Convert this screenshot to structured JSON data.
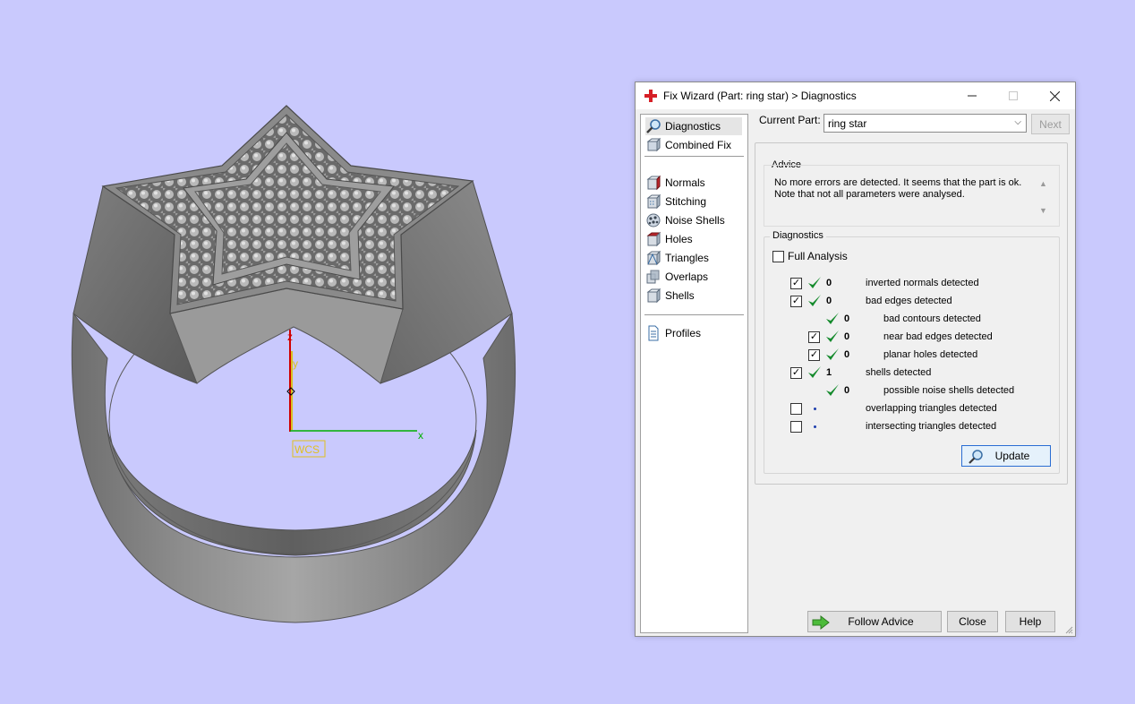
{
  "viewport": {
    "background": "#c9c9fd",
    "axes": {
      "z": "z",
      "y": "y",
      "x": "x",
      "wcs": "WCS"
    }
  },
  "window": {
    "title": "Fix Wizard (Part: ring star) > Diagnostics",
    "minimize_icon": "minimize-icon",
    "maximize_icon": "maximize-icon",
    "close_icon": "close-icon"
  },
  "nav": {
    "items": [
      {
        "label": "Diagnostics",
        "icon": "magnifier-icon"
      },
      {
        "label": "Combined Fix",
        "icon": "cubes-icon"
      },
      {
        "label": "Normals",
        "icon": "normals-icon"
      },
      {
        "label": "Stitching",
        "icon": "stitching-icon"
      },
      {
        "label": "Noise Shells",
        "icon": "noise-shells-icon"
      },
      {
        "label": "Holes",
        "icon": "holes-icon"
      },
      {
        "label": "Triangles",
        "icon": "triangles-icon"
      },
      {
        "label": "Overlaps",
        "icon": "overlaps-icon"
      },
      {
        "label": "Shells",
        "icon": "shells-icon"
      },
      {
        "label": "Profiles",
        "icon": "document-icon"
      }
    ]
  },
  "current_part": {
    "label": "Current Part:",
    "value": "ring star"
  },
  "buttons": {
    "next": "Next",
    "update": "Update",
    "follow_advice": "Follow Advice",
    "close": "Close",
    "help": "Help"
  },
  "advice": {
    "title": "Advice",
    "text_line1": "No more errors are detected. It seems that the part is ok.",
    "text_line2": "Note that not all parameters were analysed."
  },
  "diagnostics": {
    "title": "Diagnostics",
    "full_analysis": "Full Analysis",
    "rows": [
      {
        "checkbox": true,
        "checked": true,
        "status": "ok",
        "count": "0",
        "label": "inverted normals detected",
        "indent": 0
      },
      {
        "checkbox": true,
        "checked": true,
        "status": "ok",
        "count": "0",
        "label": "bad edges detected",
        "indent": 0
      },
      {
        "checkbox": false,
        "checked": false,
        "status": "ok",
        "count": "0",
        "label": "bad contours detected",
        "indent": 1
      },
      {
        "checkbox": true,
        "checked": true,
        "status": "ok",
        "count": "0",
        "label": "near bad edges detected",
        "indent": 1
      },
      {
        "checkbox": true,
        "checked": true,
        "status": "ok",
        "count": "0",
        "label": "planar holes detected",
        "indent": 1
      },
      {
        "checkbox": true,
        "checked": true,
        "status": "ok",
        "count": "1",
        "label": "shells detected",
        "indent": 0
      },
      {
        "checkbox": false,
        "checked": false,
        "status": "ok",
        "count": "0",
        "label": "possible noise shells detected",
        "indent": 1
      },
      {
        "checkbox": true,
        "checked": false,
        "status": "pending",
        "count": "",
        "label": "overlapping triangles detected",
        "indent": 0
      },
      {
        "checkbox": true,
        "checked": false,
        "status": "pending",
        "count": "",
        "label": "intersecting triangles detected",
        "indent": 0
      }
    ]
  }
}
